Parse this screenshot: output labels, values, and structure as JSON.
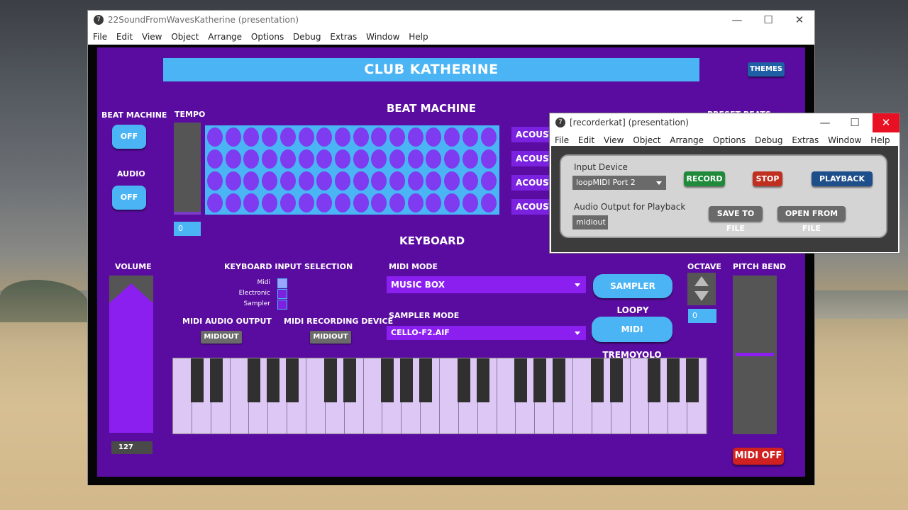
{
  "main_window": {
    "title": "22SoundFromWavesKatherine (presentation)",
    "menu": [
      "File",
      "Edit",
      "View",
      "Object",
      "Arrange",
      "Options",
      "Debug",
      "Extras",
      "Window",
      "Help"
    ],
    "controls": {
      "minimize": "—",
      "maximize": "☐",
      "close": "✕"
    }
  },
  "patch": {
    "header_title": "CLUB KATHERINE",
    "themes_label": "THEMES",
    "beat_machine_title": "BEAT MACHINE",
    "beat_machine_label": "BEAT MACHINE",
    "beat_machine_toggle": "OFF",
    "audio_label": "AUDIO",
    "audio_toggle": "OFF",
    "tempo_label": "TEMPO",
    "tempo_value": "0",
    "preset_label": "PRESET BEATS",
    "acoustic_buttons": [
      "ACOUST",
      "ACOUST",
      "ACOUST",
      "ACOUST"
    ],
    "keyboard_title": "KEYBOARD",
    "volume_label": "VOLUME",
    "volume_value": "127",
    "volume_level": 0.95,
    "keyboard_input_label": "KEYBOARD INPUT SELECTION",
    "input_options": [
      "Midi",
      "Electronic",
      "Sampler"
    ],
    "selected_input": 0,
    "midi_audio_output_label": "MIDI AUDIO OUTPUT",
    "midi_audio_output_value": "MIDIOUT",
    "midi_recording_device_label": "MIDI RECORDING DEVICE",
    "midi_recording_device_value": "MIDIOUT",
    "midi_mode_label": "MIDI MODE",
    "midi_mode_value": "MUSIC BOX",
    "sampler_mode_label": "SAMPLER MODE",
    "sampler_mode_value": "CELLO-F2.AIF",
    "sampler_loopy_label": "SAMPLER LOOPY",
    "midi_tremoyolo_label": "MIDI TREMOYOLO",
    "octave_label": "OCTAVE",
    "octave_value": "0",
    "pitch_bend_label": "PITCH BEND",
    "midi_off_label": "MIDI OFF",
    "colors": {
      "patch_bg": "#5a0ca0",
      "accent_blue": "#4ab4f5",
      "purple": "#8a1ff0",
      "midi_off": "#d02020"
    }
  },
  "recorder_window": {
    "title": "[recorderkat] (presentation)",
    "menu": [
      "File",
      "Edit",
      "View",
      "Object",
      "Arrange",
      "Options",
      "Debug",
      "Extras",
      "Window",
      "Help"
    ],
    "input_device_label": "Input Device",
    "input_device_value": "loopMIDI Port 2",
    "audio_output_label": "Audio Output for Playback",
    "audio_output_value": "midiout",
    "record_label": "RECORD",
    "stop_label": "STOP",
    "playback_label": "PLAYBACK",
    "save_label": "SAVE TO FILE",
    "open_label": "OPEN FROM FILE"
  }
}
